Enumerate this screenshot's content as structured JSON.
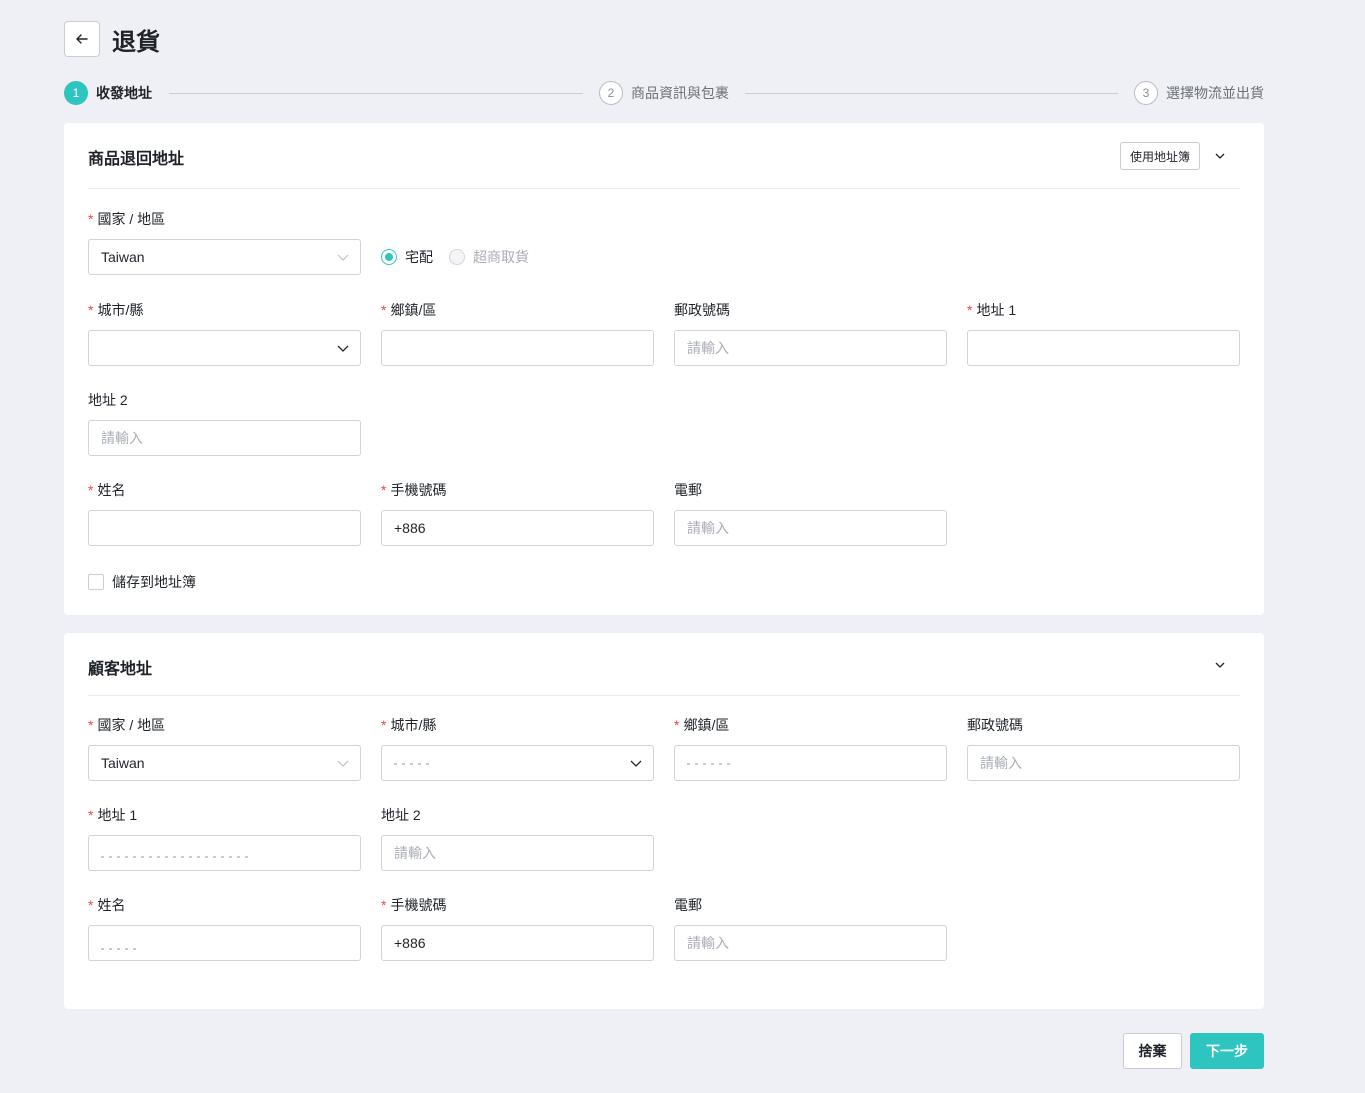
{
  "page": {
    "title": "退貨"
  },
  "colors": {
    "accent": "#2ec4c0",
    "required": "#e5484d",
    "background": "#eef0f5"
  },
  "steps": [
    {
      "number": "1",
      "label": "收發地址",
      "state": "active"
    },
    {
      "number": "2",
      "label": "商品資訊與包裹",
      "state": "pending"
    },
    {
      "number": "3",
      "label": "選擇物流並出貨",
      "state": "pending"
    }
  ],
  "return_address": {
    "title": "商品退回地址",
    "address_book_button": "使用地址簿",
    "country": {
      "label": "國家 / 地區",
      "value": "Taiwan"
    },
    "delivery": {
      "home": {
        "label": "宅配",
        "checked": true
      },
      "store": {
        "label": "超商取貨",
        "disabled": true
      }
    },
    "city": {
      "label": "城市/縣",
      "value": ""
    },
    "district": {
      "label": "鄉鎮/區",
      "value": ""
    },
    "postal": {
      "label": "郵政號碼",
      "placeholder": "請輸入"
    },
    "address1": {
      "label": "地址 1",
      "value": ""
    },
    "address2": {
      "label": "地址 2",
      "placeholder": "請輸入"
    },
    "name": {
      "label": "姓名",
      "value": ""
    },
    "phone": {
      "label": "手機號碼",
      "value": "+886"
    },
    "email": {
      "label": "電郵",
      "placeholder": "請輸入"
    },
    "save_checkbox": {
      "label": "儲存到地址簿",
      "checked": false
    }
  },
  "customer_address": {
    "title": "顧客地址",
    "country": {
      "label": "國家 / 地區",
      "value": "Taiwan"
    },
    "city": {
      "label": "城市/縣"
    },
    "district": {
      "label": "鄉鎮/區"
    },
    "postal": {
      "label": "郵政號碼",
      "placeholder": "請輸入"
    },
    "address1": {
      "label": "地址 1"
    },
    "address2": {
      "label": "地址 2",
      "placeholder": "請輸入"
    },
    "name": {
      "label": "姓名"
    },
    "phone": {
      "label": "手機號碼",
      "value": "+886"
    },
    "email": {
      "label": "電郵",
      "placeholder": "請輸入"
    }
  },
  "footer": {
    "cancel": "捨棄",
    "next": "下一步"
  }
}
